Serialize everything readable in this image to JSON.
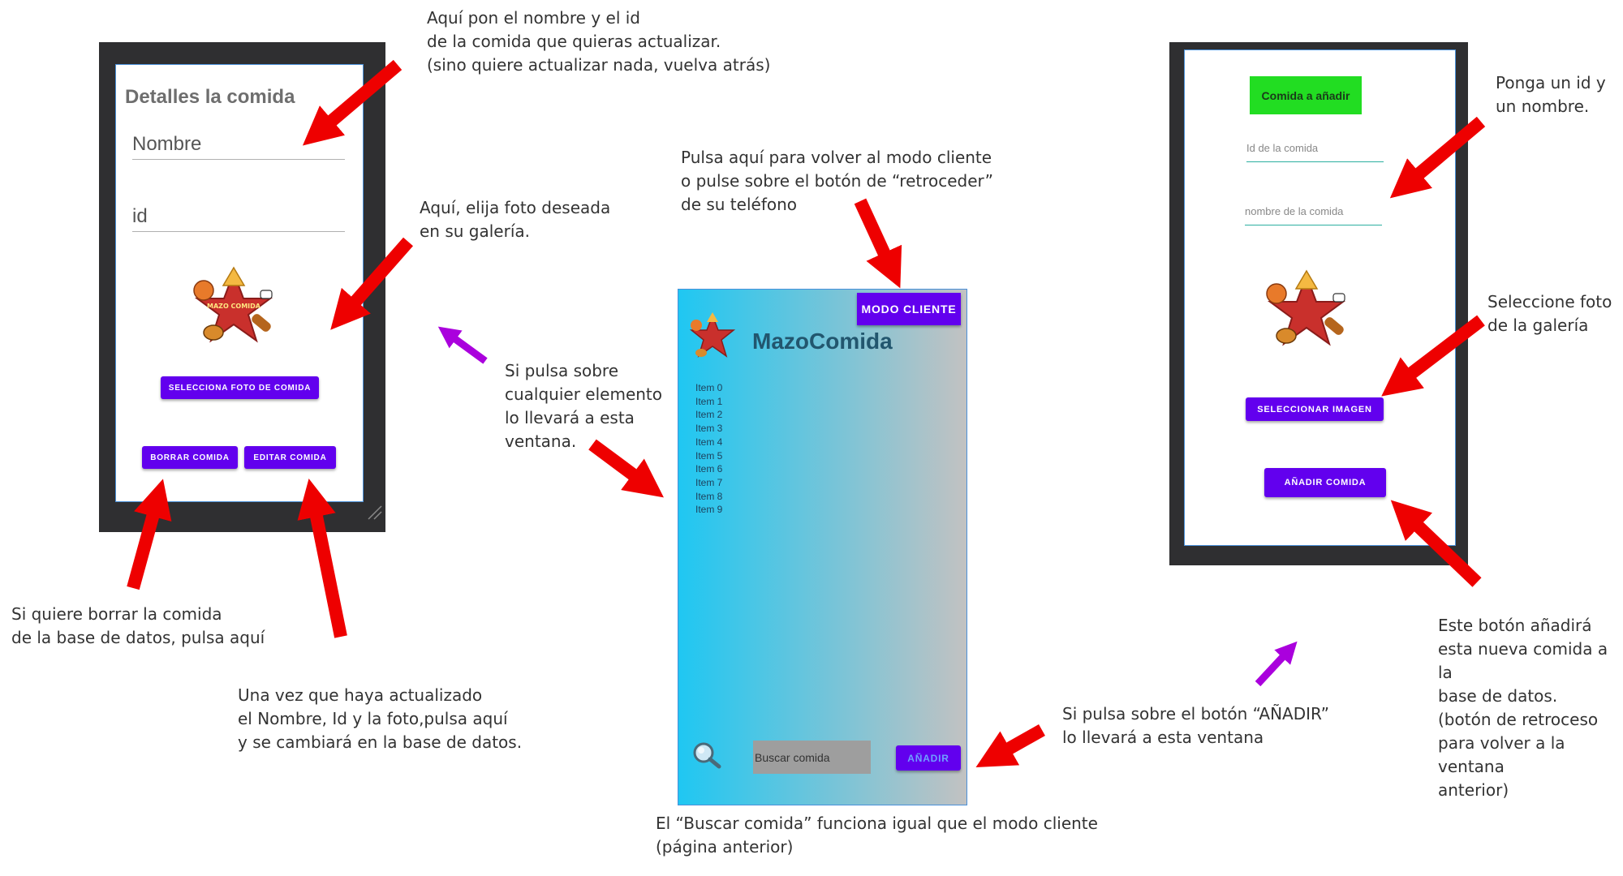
{
  "screen_edit": {
    "title": "Detalles la comida",
    "name_placeholder": "Nombre",
    "id_placeholder": "id",
    "select_photo_button": "SELECCIONA FOTO DE COMIDA",
    "delete_button": "BORRAR COMIDA",
    "edit_button": "EDITAR COMIDA",
    "logo_text": "MAZO COMIDA"
  },
  "screen_admin": {
    "mode_client_button": "MODO CLIENTE",
    "app_title": "MazoComida",
    "items": [
      "Item 0",
      "Item 1",
      "Item 2",
      "Item 3",
      "Item 4",
      "Item 5",
      "Item 6",
      "Item 7",
      "Item 8",
      "Item 9"
    ],
    "search_placeholder": "Buscar comida",
    "add_button": "AÑADIR",
    "gradient_colors": [
      "#1fc7f2",
      "#c2c2c2"
    ]
  },
  "screen_add": {
    "title": "Comida a añadir",
    "id_placeholder": "Id de la comida",
    "name_placeholder": "nombre de la comida",
    "select_image_button": "SELECCIONAR IMAGEN",
    "add_food_button": "AÑADIR COMIDA",
    "title_bg": "#22dd22"
  },
  "notes": {
    "edit_name_id": "Aquí pon el nombre y el id\nde la comida que quieras actualizar.\n(sino quiere actualizar nada, vuelva atrás)",
    "edit_photo": "Aquí, elija foto deseada\nen su galería.",
    "edit_delete": "Si quiere borrar la comida\nde la base de datos, pulsa aquí",
    "edit_update": "Una vez que haya actualizado\nel Nombre, Id y la foto,pulsa aquí\ny se cambiará en la base de datos.",
    "list_click": "Si pulsa sobre\ncualquier elemento\nlo llevará a esta\nventana.",
    "mode_client": "Pulsa aquí para volver al modo cliente\no pulse sobre el botón de “retroceder”\nde su teléfono",
    "search_same": "El “Buscar comida” funciona igual que el modo cliente\n(página anterior)",
    "add_click": "Si pulsa sobre el botón “AÑADIR”\nlo llevará a esta ventana",
    "add_id_name": "Ponga un id y\nun nombre.",
    "add_photo": "Seleccione foto\nde la galería",
    "add_button_note": "Este botón añadirá\nesta nueva comida a la\nbase de datos.\n(botón de retroceso\npara volver a la ventana\nanterior)"
  },
  "colors": {
    "accent": "#6200ee",
    "arrow_red": "#ee0000",
    "arrow_purple": "#aa00dd",
    "frame": "#2f2f31"
  }
}
